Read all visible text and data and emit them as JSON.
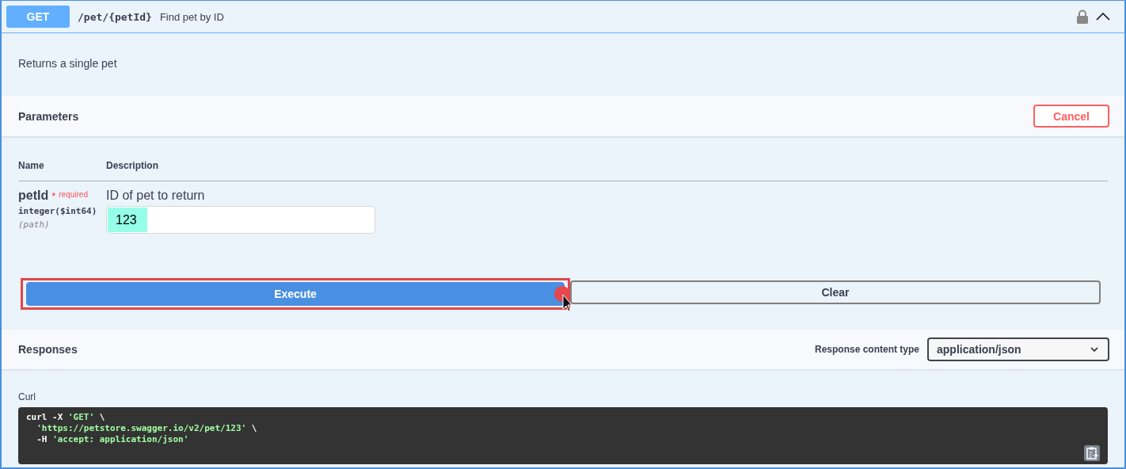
{
  "operation": {
    "method": "GET",
    "path": "/pet/{petId}",
    "summary": "Find pet by ID",
    "locked": true,
    "expanded": true
  },
  "description": "Returns a single pet",
  "parameters": {
    "title": "Parameters",
    "cancel_button": "Cancel",
    "columns": [
      "Name",
      "Description"
    ],
    "rows": [
      {
        "name": "petId",
        "required_mark": "*",
        "required_label": "required",
        "type": "integer($int64)",
        "location": "(path)",
        "description": "ID of pet to return",
        "value": "123"
      }
    ]
  },
  "actions": [
    {
      "label": "Execute",
      "kind": "primary",
      "highlighted": true
    },
    {
      "label": "Clear",
      "kind": "secondary",
      "highlighted": false
    }
  ],
  "responses": {
    "title": "Responses",
    "content_type_label": "Response content type",
    "content_type": "application/json"
  },
  "curl": {
    "label": "Curl",
    "lines": [
      {
        "parts": [
          {
            "text": "curl -X ",
            "kind": "plain"
          },
          {
            "text": "'GET'",
            "kind": "string"
          },
          {
            "text": " \\",
            "kind": "plain"
          }
        ]
      },
      {
        "parts": [
          {
            "text": "  'https://petstore.swagger.io/v2/pet/123'",
            "kind": "string"
          },
          {
            "text": " \\",
            "kind": "plain"
          }
        ]
      },
      {
        "parts": [
          {
            "text": "  -H ",
            "kind": "plain"
          },
          {
            "text": "'accept: application/json'",
            "kind": "string"
          }
        ]
      }
    ]
  }
}
